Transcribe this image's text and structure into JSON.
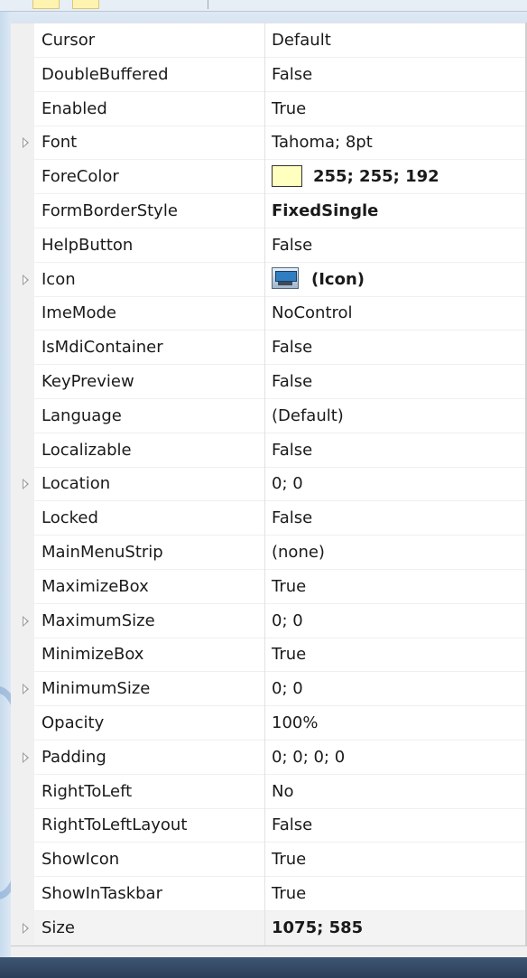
{
  "window": {
    "title": ""
  },
  "toolbar": {
    "buttons": [
      "",
      ""
    ]
  },
  "colors": {
    "forecolor_swatch": "#FFFFC0",
    "background": "#cfe0ef",
    "statusbar": "#2b3f59"
  },
  "properties": [
    {
      "name": "Cursor",
      "value": "Default",
      "expandable": false,
      "bold": false
    },
    {
      "name": "DoubleBuffered",
      "value": "False",
      "expandable": false,
      "bold": false
    },
    {
      "name": "Enabled",
      "value": "True",
      "expandable": false,
      "bold": false
    },
    {
      "name": "Font",
      "value": "Tahoma; 8pt",
      "expandable": true,
      "bold": false
    },
    {
      "name": "ForeColor",
      "value": "255; 255; 192",
      "expandable": false,
      "bold": true,
      "swatch": "color-swatch"
    },
    {
      "name": "FormBorderStyle",
      "value": "FixedSingle",
      "expandable": false,
      "bold": true
    },
    {
      "name": "HelpButton",
      "value": "False",
      "expandable": false,
      "bold": false
    },
    {
      "name": "Icon",
      "value": "(Icon)",
      "expandable": true,
      "bold": true,
      "swatch": "form-icon"
    },
    {
      "name": "ImeMode",
      "value": "NoControl",
      "expandable": false,
      "bold": false
    },
    {
      "name": "IsMdiContainer",
      "value": "False",
      "expandable": false,
      "bold": false
    },
    {
      "name": "KeyPreview",
      "value": "False",
      "expandable": false,
      "bold": false
    },
    {
      "name": "Language",
      "value": "(Default)",
      "expandable": false,
      "bold": false
    },
    {
      "name": "Localizable",
      "value": "False",
      "expandable": false,
      "bold": false
    },
    {
      "name": "Location",
      "value": "0; 0",
      "expandable": true,
      "bold": false
    },
    {
      "name": "Locked",
      "value": "False",
      "expandable": false,
      "bold": false
    },
    {
      "name": "MainMenuStrip",
      "value": "(none)",
      "expandable": false,
      "bold": false
    },
    {
      "name": "MaximizeBox",
      "value": "True",
      "expandable": false,
      "bold": false
    },
    {
      "name": "MaximumSize",
      "value": "0; 0",
      "expandable": true,
      "bold": false
    },
    {
      "name": "MinimizeBox",
      "value": "True",
      "expandable": false,
      "bold": false
    },
    {
      "name": "MinimumSize",
      "value": "0; 0",
      "expandable": true,
      "bold": false
    },
    {
      "name": "Opacity",
      "value": "100%",
      "expandable": false,
      "bold": false
    },
    {
      "name": "Padding",
      "value": "0; 0; 0; 0",
      "expandable": true,
      "bold": false
    },
    {
      "name": "RightToLeft",
      "value": "No",
      "expandable": false,
      "bold": false
    },
    {
      "name": "RightToLeftLayout",
      "value": "False",
      "expandable": false,
      "bold": false
    },
    {
      "name": "ShowIcon",
      "value": "True",
      "expandable": false,
      "bold": false
    },
    {
      "name": "ShowInTaskbar",
      "value": "True",
      "expandable": false,
      "bold": false
    },
    {
      "name": "Size",
      "value": "1075; 585",
      "expandable": true,
      "bold": true,
      "selected": true
    }
  ]
}
